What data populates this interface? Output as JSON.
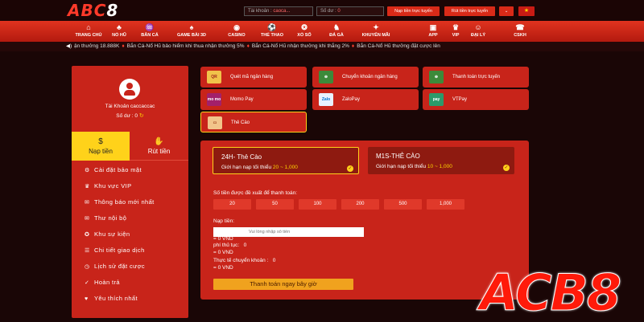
{
  "header": {
    "logo_main": "ABC",
    "logo_num": "8",
    "username_label": "Tài khoản :",
    "username_value": "caoca...",
    "balance_label": "Số dư :",
    "balance_value": "0",
    "btn_deposit_online": "Nạp tiền trực tuyến",
    "btn_withdraw_online": "Rút tiền trực tuyến",
    "dropdown_glyph": "⌄",
    "flag_glyph": "★"
  },
  "nav": [
    {
      "label": "TRANG CHỦ",
      "icon": "⌂"
    },
    {
      "label": "NỔ HŨ",
      "icon": "♣"
    },
    {
      "label": "BẮN CÁ",
      "icon": "♒"
    },
    {
      "label": "GAME BÀI 3D",
      "icon": "♠"
    },
    {
      "label": "CASINO",
      "icon": "◉"
    },
    {
      "label": "THỂ THAO",
      "icon": "⚽"
    },
    {
      "label": "XỔ SỐ",
      "icon": "❂"
    },
    {
      "label": "ĐÁ GÀ",
      "icon": "♞"
    },
    {
      "label": "KHUYẾN MÃI",
      "icon": "✦"
    },
    {
      "label": "APP",
      "icon": "▣"
    },
    {
      "label": "VIP",
      "icon": "♛"
    },
    {
      "label": "ĐẠI LÝ",
      "icon": "☺"
    },
    {
      "label": "CSKH",
      "icon": "☎"
    }
  ],
  "ticker": {
    "items": [
      "ận thưởng 18.888K",
      "Bắn Cá-Nổ Hũ bảo hiểm khi thua nhận thưởng 5%",
      "Bắn Cá-Nổ Hũ nhận thưởng khi thắng 2%",
      "Bắn Cá-Nổ Hũ thưởng đặt cược lên"
    ]
  },
  "sidebar": {
    "account_name": "Tài Khoản caccaccac",
    "balance_label": "Số dư :",
    "balance_value": "0",
    "tab_deposit": "Nạp tiền",
    "tab_withdraw": "Rút tiền",
    "menu": [
      {
        "label": "Cài đặt bảo mật",
        "icon": "⚙"
      },
      {
        "label": "Khu vực VIP",
        "icon": "♛"
      },
      {
        "label": "Thông báo mới nhất",
        "icon": "✉"
      },
      {
        "label": "Thư nội bộ",
        "icon": "✉"
      },
      {
        "label": "Khu sự kiện",
        "icon": "✪"
      },
      {
        "label": "Chi tiết giao dịch",
        "icon": "☰"
      },
      {
        "label": "Lịch sử đặt cược",
        "icon": "◷"
      },
      {
        "label": "Hoàn trả",
        "icon": "✓"
      },
      {
        "label": "Yêu thích nhất",
        "icon": "♥"
      }
    ]
  },
  "payment_methods": [
    {
      "label": "Quét mã ngân hàng",
      "icon_text": "QR",
      "icon_bg": "#f0c24a",
      "icon_fg": "#a0201a"
    },
    {
      "label": "Chuyển khoản ngân hàng",
      "icon_text": "⊕",
      "icon_bg": "#3d8a3a",
      "icon_fg": "#ffffff"
    },
    {
      "label": "Thanh toán trực tuyến",
      "icon_text": "⊕",
      "icon_bg": "#3d8a3a",
      "icon_fg": "#ffffff"
    },
    {
      "label": "Momo Pay",
      "icon_text": "mo mo",
      "icon_bg": "#a3206a",
      "icon_fg": "#ffffff"
    },
    {
      "label": "ZaloPay",
      "icon_text": "Zalo",
      "icon_bg": "#e8f0ff",
      "icon_fg": "#0070d0"
    },
    {
      "label": "VTPay",
      "icon_text": "pay",
      "icon_bg": "#2c9a6a",
      "icon_fg": "#ffffff"
    },
    {
      "label": "Thẻ Cào",
      "icon_text": "▭",
      "icon_bg": "#f2c48a",
      "icon_fg": "#a0401a"
    }
  ],
  "cards": [
    {
      "title": "24H- Thẻ Cào",
      "limit_label": "Giới hạn nạp tối thiểu",
      "limit_range": "20 ~ 1,000"
    },
    {
      "title": "M1S-THẺ CÀO",
      "limit_label": "Giới hạn nạp tối thiểu",
      "limit_range": "10 ~ 1,000"
    }
  ],
  "form": {
    "suggest_label": "Số tiền được đề xuất để thanh toán:",
    "amounts": [
      "20",
      "50",
      "100",
      "200",
      "500",
      "1,000"
    ],
    "deposit_label": "Nạp tiền:",
    "deposit_placeholder": "Vui lòng nhập số tiền",
    "deposit_vnd": "= 0 VND",
    "fee_label": "phí thủ tục:",
    "fee_value": "0",
    "fee_vnd": "= 0 VND",
    "actual_label": "Thực tế chuyển khoản :",
    "actual_value": "0",
    "actual_vnd": "= 0 VND",
    "submit_label": "Thanh toán ngay bây giờ"
  },
  "watermark": "ACB8",
  "colors": {
    "accent_red": "#c8241a",
    "accent_yellow": "#ffd21a",
    "button_orange": "#f0a21e"
  }
}
